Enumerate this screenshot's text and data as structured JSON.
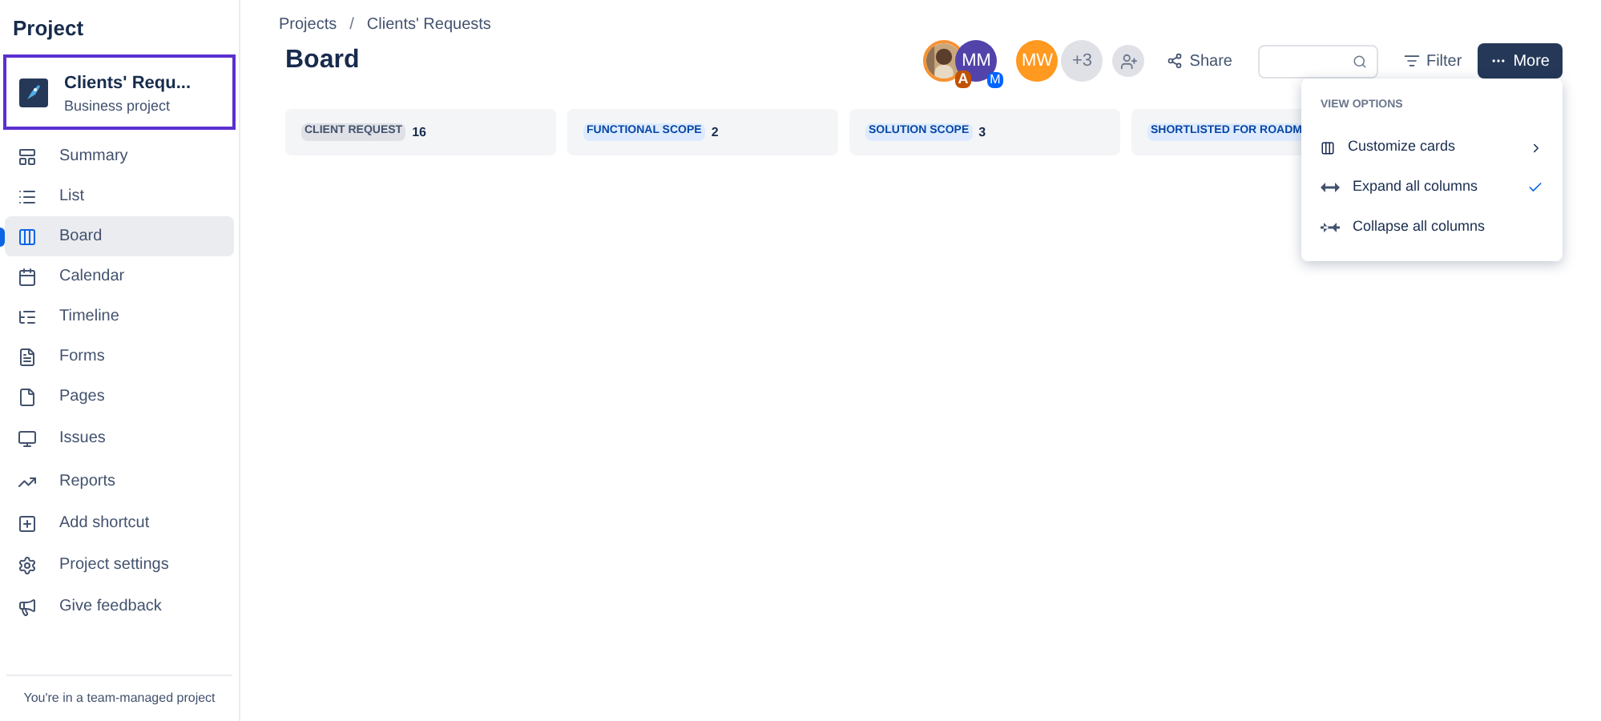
{
  "sidebar": {
    "title": "Project",
    "project": {
      "name": "Clients' Requ...",
      "type": "Business project"
    },
    "items": [
      {
        "label": "Summary",
        "selected": false
      },
      {
        "label": "List",
        "selected": false
      },
      {
        "label": "Board",
        "selected": true
      },
      {
        "label": "Calendar",
        "selected": false
      },
      {
        "label": "Timeline",
        "selected": false
      },
      {
        "label": "Forms",
        "selected": false
      },
      {
        "label": "Pages",
        "selected": false
      },
      {
        "label": "Issues",
        "selected": false
      },
      {
        "label": "Reports",
        "selected": false
      },
      {
        "label": "Add shortcut",
        "selected": false
      },
      {
        "label": "Project settings",
        "selected": false
      },
      {
        "label": "Give feedback",
        "selected": false
      }
    ],
    "footer": "You're in a team-managed project"
  },
  "breadcrumbs": [
    "Projects",
    "Clients' Requests"
  ],
  "breadcrumb_separator": "/",
  "page_title": "Board",
  "avatars": [
    {
      "kind": "picture",
      "badge": "A",
      "color": "#f79232"
    },
    {
      "kind": "initials",
      "initials": "MM",
      "badge": "M",
      "color": "#5243aa"
    },
    {
      "kind": "initials",
      "initials": "MW",
      "color": "#ff991f"
    },
    {
      "kind": "count",
      "initials": "+3",
      "color": "#dfe1e6"
    }
  ],
  "share_button": "Share",
  "filter_button": "Filter",
  "more_button": "More",
  "columns": [
    {
      "name": "CLIENT REQUEST",
      "count": "16",
      "color": "#dfe1e6"
    },
    {
      "name": "FUNCTIONAL SCOPE",
      "count": "2",
      "color": "#deebff"
    },
    {
      "name": "SOLUTION SCOPE",
      "count": "3",
      "color": "#deebff"
    },
    {
      "name": "SHORTLISTED FOR ROADM",
      "color": "#deebff"
    }
  ],
  "menu": {
    "heading": "VIEW OPTIONS",
    "items": [
      {
        "label": "Customize cards",
        "kind": "submenu"
      },
      {
        "label": "Expand all columns",
        "kind": "check",
        "selected": true
      },
      {
        "label": "Collapse all columns",
        "kind": "check",
        "selected": false
      }
    ]
  }
}
